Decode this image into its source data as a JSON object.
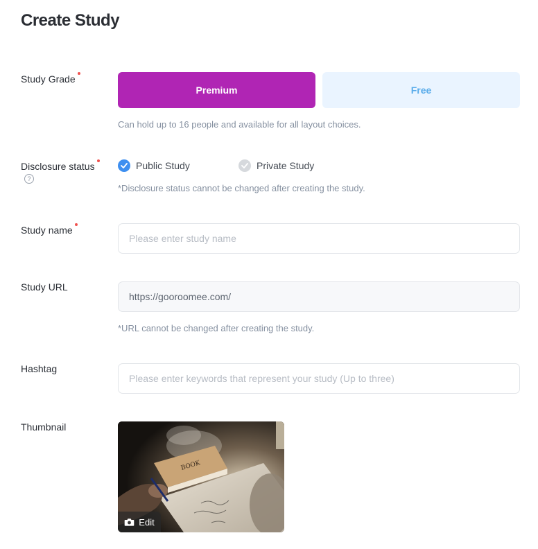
{
  "page": {
    "title": "Create Study"
  },
  "grade": {
    "label": "Study Grade",
    "options": [
      {
        "label": "Premium",
        "selected": true
      },
      {
        "label": "Free",
        "selected": false
      }
    ],
    "hint": "Can hold up to 16 people and available for all layout choices.",
    "colors": {
      "premium_bg": "#b025b4",
      "free_bg": "#eaf4ff",
      "free_text": "#5aacea"
    }
  },
  "disclosure": {
    "label": "Disclosure status",
    "help_icon": "question-circle-icon",
    "options": [
      {
        "label": "Public Study",
        "checked": true
      },
      {
        "label": "Private Study",
        "checked": false
      }
    ],
    "note": "*Disclosure status cannot be changed after creating the study."
  },
  "study_name": {
    "label": "Study name",
    "value": "",
    "placeholder": "Please enter study name"
  },
  "study_url": {
    "label": "Study URL",
    "value": "https://gooroomee.com/",
    "note": "*URL cannot be changed after creating the study."
  },
  "hashtag": {
    "label": "Hashtag",
    "value": "",
    "placeholder": "Please enter keywords that represent your study (Up to three)"
  },
  "thumbnail": {
    "label": "Thumbnail",
    "edit_label": "Edit",
    "edit_icon": "camera-icon"
  },
  "colors": {
    "required_dot": "#f0524f",
    "radio_checked": "#3d8ff0",
    "radio_unchecked": "#d6d9dd"
  }
}
